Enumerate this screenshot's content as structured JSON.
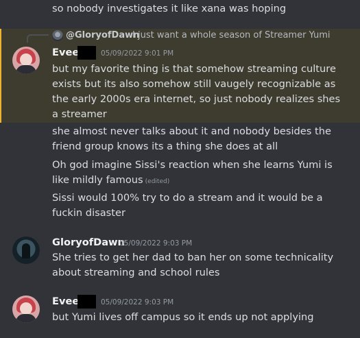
{
  "previous_message": {
    "text": "so nobody investigates it like xana was hoping"
  },
  "reply": {
    "author": "@GloryofDawn",
    "text": "I just want a whole season of Streamer Yumi"
  },
  "message_1": {
    "author": "Evee",
    "timestamp": "05/09/2022 9:01 PM",
    "lines": [
      "but my favorite thing is that somehow streaming culture",
      "exists but its also somehow still vaugely recognizable as",
      "the early 2000s era internet, so just nobody realizes shes",
      "a streamer"
    ]
  },
  "followups": [
    {
      "lines": [
        "she almost never talks about it and nobody besides the",
        "friend group knows its a thing she does at all"
      ]
    },
    {
      "lines": [
        "Oh god imagine Sissi's reaction when she learns Yumi is",
        "like mildly famous"
      ],
      "edited": "(edited)"
    },
    {
      "lines": [
        "Sissi would 100% try to do a stream and it would be a",
        "fuckin disaster"
      ]
    }
  ],
  "message_2": {
    "author": "GloryofDawn",
    "timestamp": "05/09/2022 9:03 PM",
    "lines": [
      "She tries to get her dad to ban her on some technicality",
      "about streaming and school rules"
    ]
  },
  "message_3": {
    "author": "Evee",
    "timestamp": "05/09/2022 9:03 PM",
    "lines": [
      "but Yumi lives off campus so it ends up not applying"
    ]
  },
  "colors": {
    "background": "#313338",
    "mention_highlight": "#3e3b2f",
    "mention_bar": "#f0b232",
    "text": "#dbdee1",
    "muted": "#949ba4"
  },
  "icons": {
    "reply_spine": "reply-spine-icon"
  }
}
